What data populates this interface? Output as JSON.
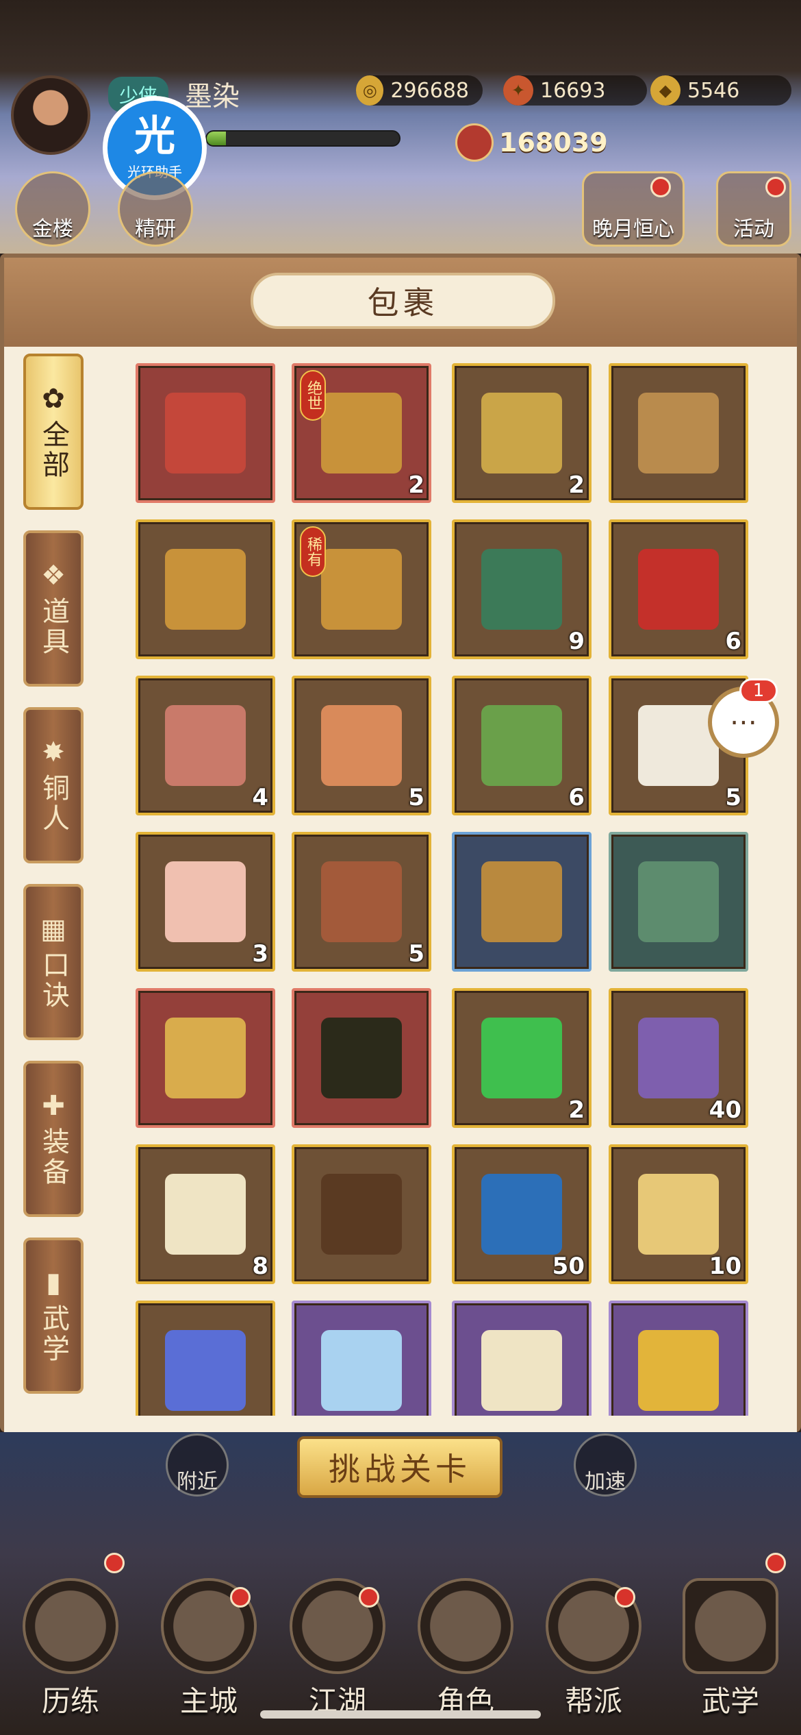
{
  "header": {
    "vip_label": "少侠",
    "player_name": "墨染",
    "xp_fraction": 0.1,
    "currencies": [
      {
        "icon": "copper-coin-icon",
        "value": "296688"
      },
      {
        "icon": "flame-token-icon",
        "value": "16693"
      },
      {
        "icon": "gold-ingot-icon",
        "value": "5546"
      }
    ],
    "power": "168039",
    "badge": {
      "big": "光",
      "small": "光环助手"
    },
    "left_buttons": [
      "金楼",
      "精研"
    ],
    "right_buttons": [
      "晚月恒心",
      "活动"
    ]
  },
  "panel": {
    "title": "包裹"
  },
  "sidebar": {
    "tabs": [
      {
        "label": "全部",
        "icon": "fan-icon",
        "active": true
      },
      {
        "label": "道具",
        "icon": "pouch-icon",
        "active": false
      },
      {
        "label": "铜人",
        "icon": "figure-icon",
        "active": false
      },
      {
        "label": "口诀",
        "icon": "scroll-icon",
        "active": false
      },
      {
        "label": "装备",
        "icon": "armor-icon",
        "active": false
      },
      {
        "label": "武学",
        "icon": "book-icon",
        "active": false
      }
    ]
  },
  "grid": {
    "items": [
      {
        "name": "red-envelope-book",
        "rarity": "red",
        "count": "",
        "tag": "",
        "art": "#c4473a"
      },
      {
        "name": "golden-book-stand",
        "rarity": "red",
        "count": "2",
        "tag": "绝世",
        "art": "#c8923a"
      },
      {
        "name": "ore-chest",
        "rarity": "gold",
        "count": "2",
        "tag": "",
        "art": "#caa548"
      },
      {
        "name": "card-chest",
        "rarity": "gold",
        "count": "",
        "tag": "",
        "art": "#b98b4d"
      },
      {
        "name": "book-stand",
        "rarity": "gold",
        "count": "",
        "tag": "",
        "art": "#c8923a"
      },
      {
        "name": "rare-book-stand",
        "rarity": "gold",
        "count": "",
        "tag": "稀有",
        "art": "#c8923a"
      },
      {
        "name": "jade-horse-bell",
        "rarity": "gold",
        "count": "9",
        "tag": "",
        "art": "#3c7a58"
      },
      {
        "name": "red-gift-book",
        "rarity": "gold",
        "count": "6",
        "tag": "",
        "art": "#c4302a"
      },
      {
        "name": "meat-plate",
        "rarity": "gold",
        "count": "4",
        "tag": "",
        "art": "#c97a6a"
      },
      {
        "name": "seafood-plate",
        "rarity": "gold",
        "count": "5",
        "tag": "",
        "art": "#d98a5a"
      },
      {
        "name": "vegetable-basket",
        "rarity": "gold",
        "count": "6",
        "tag": "",
        "art": "#6aa04a"
      },
      {
        "name": "tofu-plate",
        "rarity": "gold",
        "count": "5",
        "tag": "",
        "art": "#efe9dc"
      },
      {
        "name": "chicken-plate",
        "rarity": "gold",
        "count": "3",
        "tag": "",
        "art": "#f0c0b0"
      },
      {
        "name": "grain-plate",
        "rarity": "gold",
        "count": "5",
        "tag": "",
        "art": "#a35a3a"
      },
      {
        "name": "weapon-chest-blue",
        "rarity": "blue",
        "count": "",
        "tag": "",
        "art": "#b9893e"
      },
      {
        "name": "weapon-chest-green",
        "rarity": "green",
        "count": "",
        "tag": "",
        "art": "#5d8c6e"
      },
      {
        "name": "gold-nugget",
        "rarity": "red",
        "count": "",
        "tag": "",
        "art": "#d9ac4c"
      },
      {
        "name": "special-stone",
        "rarity": "red",
        "count": "",
        "tag": "",
        "art": "#2b2a1a"
      },
      {
        "name": "green-orb",
        "rarity": "gold",
        "count": "2",
        "tag": "",
        "art": "#3fbf4e"
      },
      {
        "name": "rainbow-flower",
        "rarity": "gold",
        "count": "40",
        "tag": "",
        "art": "#7e5fae"
      },
      {
        "name": "qianji-manual",
        "rarity": "gold",
        "count": "8",
        "tag": "",
        "art": "#efe4c4"
      },
      {
        "name": "qianji-tome",
        "rarity": "gold",
        "count": "",
        "tag": "",
        "art": "#5a3a22"
      },
      {
        "name": "water-orb",
        "rarity": "gold",
        "count": "50",
        "tag": "",
        "art": "#2c6fb8"
      },
      {
        "name": "golden-scroll",
        "rarity": "gold",
        "count": "10",
        "tag": "",
        "art": "#e7c877"
      },
      {
        "name": "move-orb",
        "rarity": "gold",
        "count": "",
        "tag": "",
        "art": "#5a6ed6"
      },
      {
        "name": "crystal-gem",
        "rarity": "purple",
        "count": "",
        "tag": "",
        "art": "#a9d2f0"
      },
      {
        "name": "arena-scroll",
        "rarity": "purple",
        "count": "",
        "tag": "",
        "art": "#efe4c4"
      },
      {
        "name": "gold-star",
        "rarity": "purple",
        "count": "",
        "tag": "",
        "art": "#e2b43a"
      }
    ]
  },
  "chat": {
    "badge": "1",
    "glyph": "⋯"
  },
  "bottom": {
    "challenge": "挑战关卡",
    "nearby": "附近",
    "speed": "加速",
    "nav": [
      "历练",
      "主城",
      "江湖",
      "角色",
      "帮派",
      "武学"
    ]
  }
}
